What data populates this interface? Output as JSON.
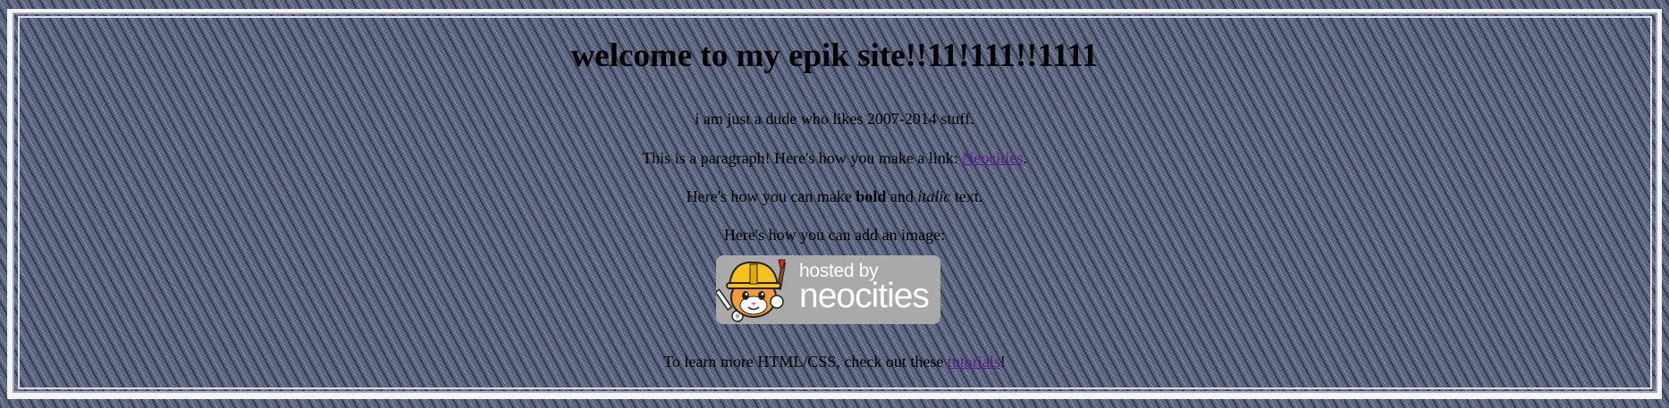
{
  "page": {
    "heading": "welcome to my epik site!!11!111!!1111",
    "intro": "i am just a dude who likes 2007-2014 stuff.",
    "paragraph_link": {
      "before": "This is a paragraph! Here's how you make a link: ",
      "link_text": "Neocities",
      "after": "."
    },
    "format_line": {
      "before": "Here's how you can make ",
      "bold": "bold",
      "middle": " and ",
      "italic": "italic",
      "after": " text."
    },
    "image_line": "Here's how you can add an image:",
    "badge": {
      "top_text": "hosted by",
      "main_text": "neocities",
      "icon": "neocities-cat-mascot-icon",
      "background_color": "#a9a9a9"
    },
    "learn_line": {
      "before": "To learn more HTML/CSS, check out these ",
      "link_text": "tutorials",
      "after": "!"
    }
  },
  "colors": {
    "background": "#5a6480",
    "frame": "#f4f4f4",
    "text": "#000000",
    "link_visited": "#551a8b"
  }
}
